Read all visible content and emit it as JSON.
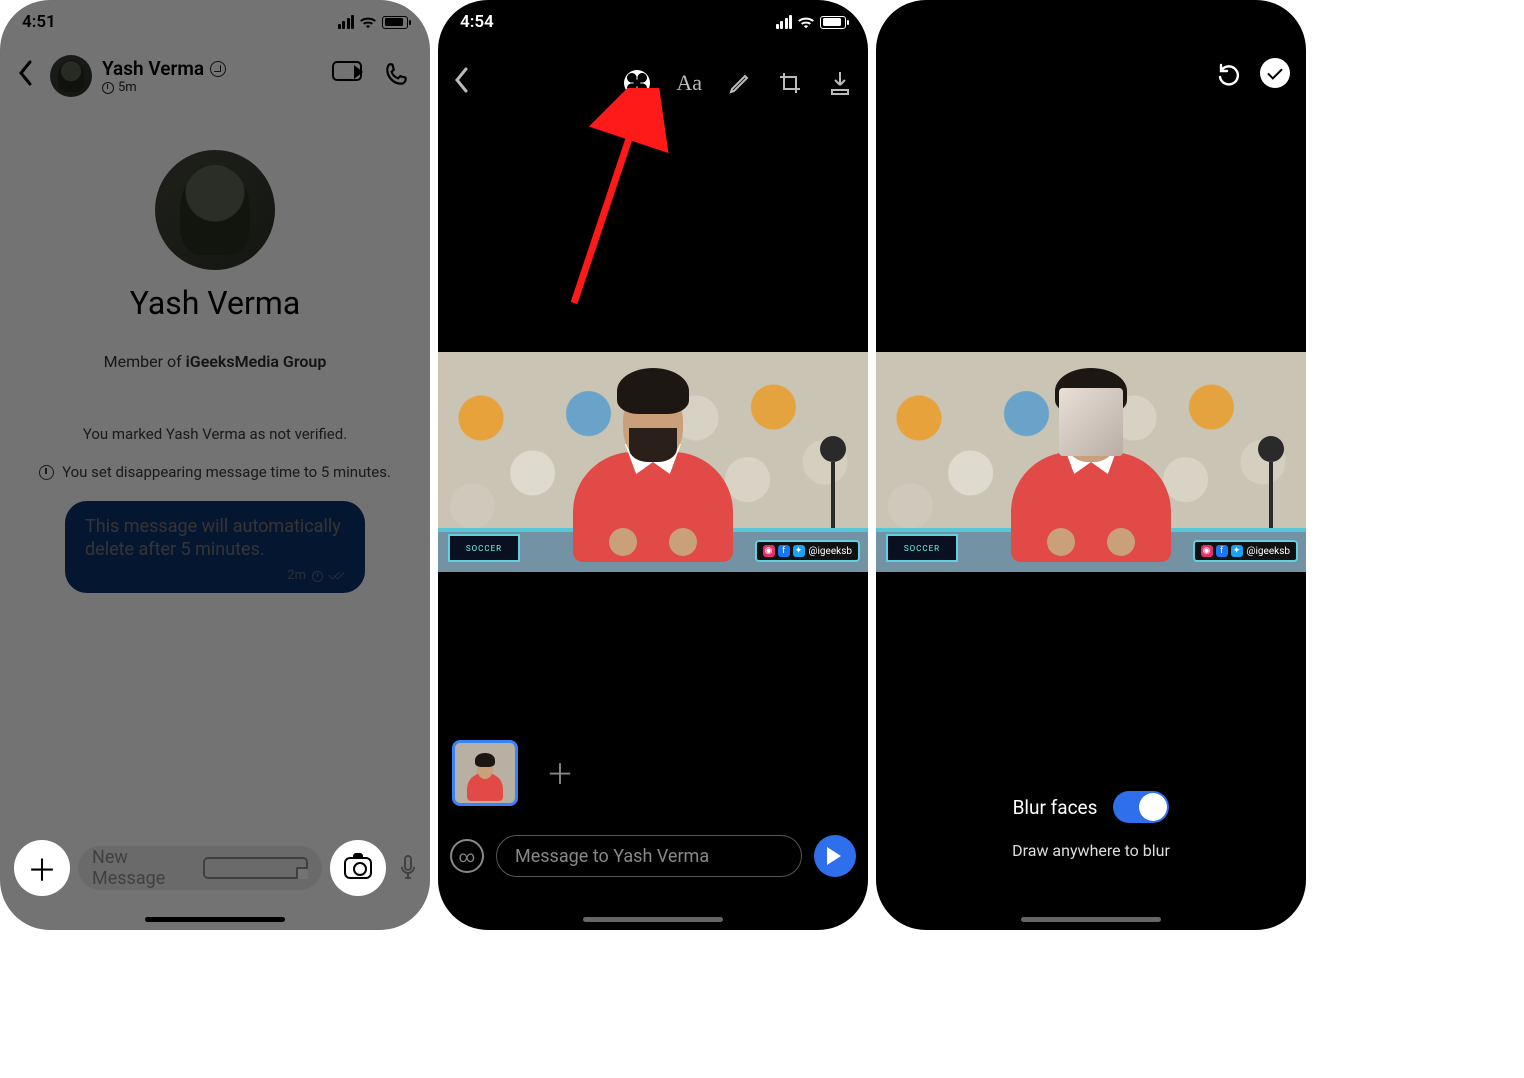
{
  "screen1": {
    "status_time": "4:51",
    "header": {
      "name": "Yash Verma",
      "subtitle": "5m"
    },
    "profile": {
      "name": "Yash Verma",
      "member_prefix": "Member of ",
      "member_group": "iGeeksMedia Group"
    },
    "system": {
      "verified": "You marked Yash Verma as not verified.",
      "timer": "You set disappearing message time to 5 minutes."
    },
    "bubble": {
      "text": "This message will automatically delete after 5 minutes.",
      "meta_time": "2m"
    },
    "input": {
      "placeholder": "New Message"
    }
  },
  "screen2": {
    "status_time": "4:54",
    "toolbar": {
      "text_label": "Aa"
    },
    "tag_handle": "@igeeksb",
    "soccer_label": "SOCCER",
    "input_placeholder": "Message to Yash Verma",
    "view_once_symbol": "∞"
  },
  "screen3": {
    "tag_handle": "@igeeksb",
    "soccer_label": "SOCCER",
    "blur_faces_label": "Blur faces",
    "hint": "Draw anywhere to blur"
  }
}
